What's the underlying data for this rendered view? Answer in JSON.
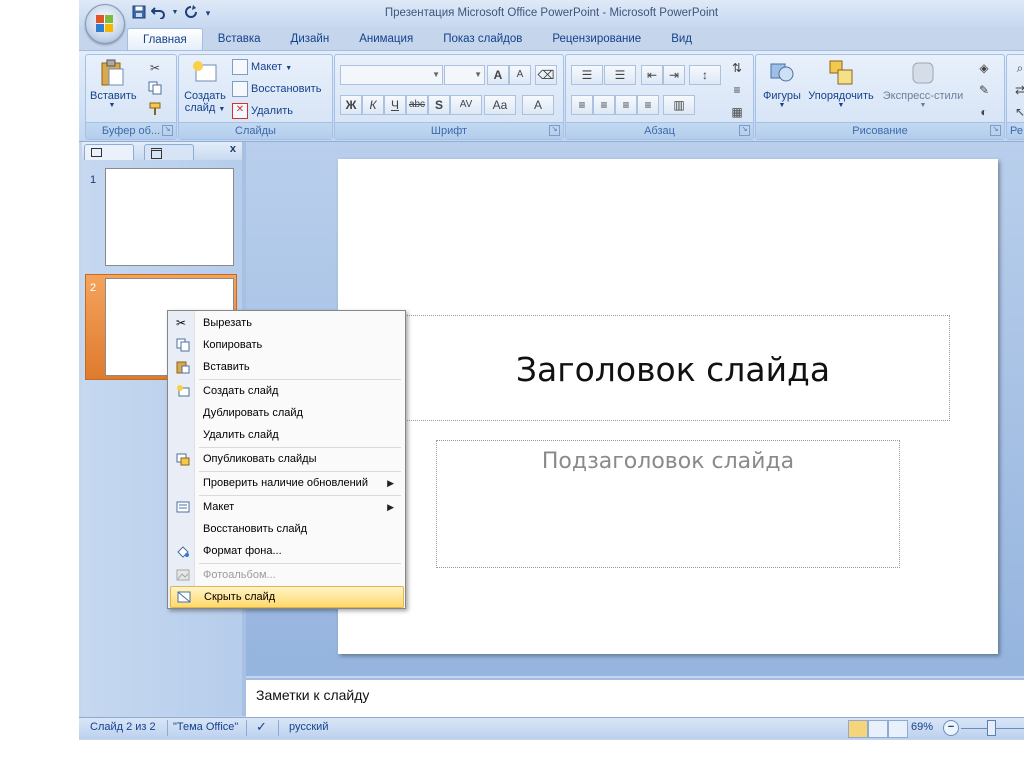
{
  "window": {
    "title": "Презентация Microsoft Office PowerPoint - Microsoft PowerPoint"
  },
  "quick_access": {
    "icons": [
      "save-icon",
      "undo-icon",
      "redo-icon",
      "customize-icon"
    ]
  },
  "ribbon": {
    "tabs": [
      "Главная",
      "Вставка",
      "Дизайн",
      "Анимация",
      "Показ слайдов",
      "Рецензирование",
      "Вид"
    ],
    "active_tab": "Главная",
    "groups": {
      "clipboard": {
        "label": "Буфер об...",
        "paste": "Вставить"
      },
      "slides": {
        "label": "Слайды",
        "new_slide": "Создать",
        "new_slide_2": "слайд",
        "layout": "Макет",
        "reset": "Восстановить",
        "delete": "Удалить"
      },
      "font": {
        "label": "Шрифт",
        "bold": "Ж",
        "italic": "К",
        "underline": "Ч",
        "strike": "abc",
        "shadow": "S",
        "spacing": "AV",
        "case": "Aa",
        "color": "A",
        "grow": "A",
        "shrink": "A"
      },
      "paragraph": {
        "label": "Абзац"
      },
      "drawing": {
        "label": "Рисование",
        "shapes": "Фигуры",
        "arrange": "Упорядочить",
        "styles": "Экспресс-стили"
      },
      "editing": {
        "label": "Ре"
      }
    }
  },
  "slides_panel": {
    "slides": [
      {
        "number": "1"
      },
      {
        "number": "2"
      }
    ],
    "close": "x"
  },
  "slide": {
    "title": "Заголовок слайда",
    "subtitle": "Подзаголовок слайда"
  },
  "notes": {
    "placeholder": "Заметки к слайду"
  },
  "context_menu": {
    "items": [
      {
        "label": "Вырезать",
        "icon": "scissors-icon",
        "enabled": true
      },
      {
        "label": "Копировать",
        "icon": "copy-icon",
        "enabled": true
      },
      {
        "label": "Вставить",
        "icon": "paste-icon",
        "enabled": true
      },
      {
        "label": "Создать слайд",
        "icon": "new-slide-icon",
        "enabled": true
      },
      {
        "label": "Дублировать слайд",
        "icon": "",
        "enabled": true
      },
      {
        "label": "Удалить слайд",
        "icon": "",
        "enabled": true
      },
      {
        "label": "Опубликовать слайды",
        "icon": "publish-icon",
        "enabled": true
      },
      {
        "label": "Проверить наличие обновлений",
        "icon": "",
        "enabled": true,
        "submenu": true
      },
      {
        "label": "Макет",
        "icon": "layout-icon",
        "enabled": true,
        "submenu": true
      },
      {
        "label": "Восстановить слайд",
        "icon": "",
        "enabled": true
      },
      {
        "label": "Формат фона...",
        "icon": "format-background-icon",
        "enabled": true
      },
      {
        "label": "Фотоальбом...",
        "icon": "photo-album-icon",
        "enabled": false
      },
      {
        "label": "Скрыть слайд",
        "icon": "hide-slide-icon",
        "enabled": true,
        "highlighted": true
      }
    ]
  },
  "status_bar": {
    "slide_info": "Слайд 2 из 2",
    "theme": "\"Тема Office\"",
    "language": "русский",
    "zoom": "69%",
    "zoom_minus": "−"
  },
  "colors": {
    "ribbon": "#dbe7f7",
    "accent_orange": "#e8842f",
    "highlight": "#ffd96b"
  }
}
